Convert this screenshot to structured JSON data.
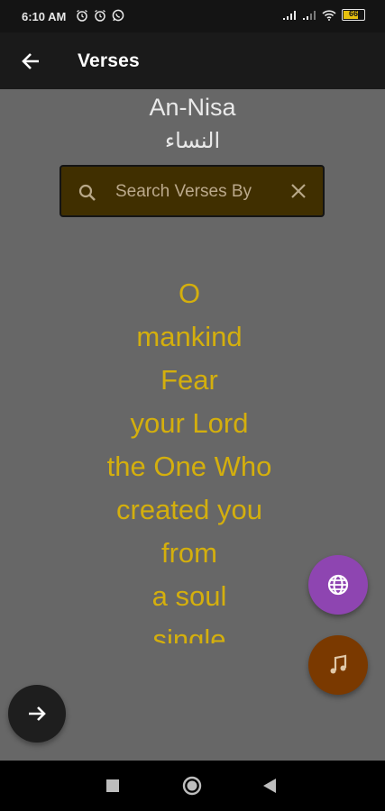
{
  "status_bar": {
    "time": "6:10 AM",
    "left_icons": [
      "alarm-icon",
      "alarm-icon",
      "whatsapp-icon"
    ],
    "right_icons": [
      "signal-icon",
      "signal-icon",
      "wifi-icon",
      "battery-icon"
    ],
    "battery_level": "66"
  },
  "app_bar": {
    "title": "Verses",
    "back_icon": "arrow-back-icon"
  },
  "surah": {
    "name_en": "An-Nisa",
    "name_ar": "النساء"
  },
  "search": {
    "placeholder": "Search Verses By",
    "value": "",
    "search_icon": "search-icon",
    "clear_icon": "close-icon"
  },
  "verse": {
    "lines": [
      "O",
      "mankind",
      "Fear",
      "your Lord",
      "the One Who",
      "created you",
      "from",
      "a soul",
      "single"
    ]
  },
  "fabs": {
    "globe_icon": "globe-icon",
    "music_icon": "music-note-icon",
    "next_icon": "arrow-forward-icon"
  },
  "nav_bar": {
    "buttons": [
      "recents-square-icon",
      "home-circle-icon",
      "back-triangle-icon"
    ]
  },
  "colors": {
    "background": "#676767",
    "app_bar": "#1a1a1a",
    "verse_text": "#d4af0d",
    "search_bg": "#402f00",
    "fab_globe": "#8e45b1",
    "fab_music": "#7a3900",
    "fab_next": "#1e1e1e"
  }
}
